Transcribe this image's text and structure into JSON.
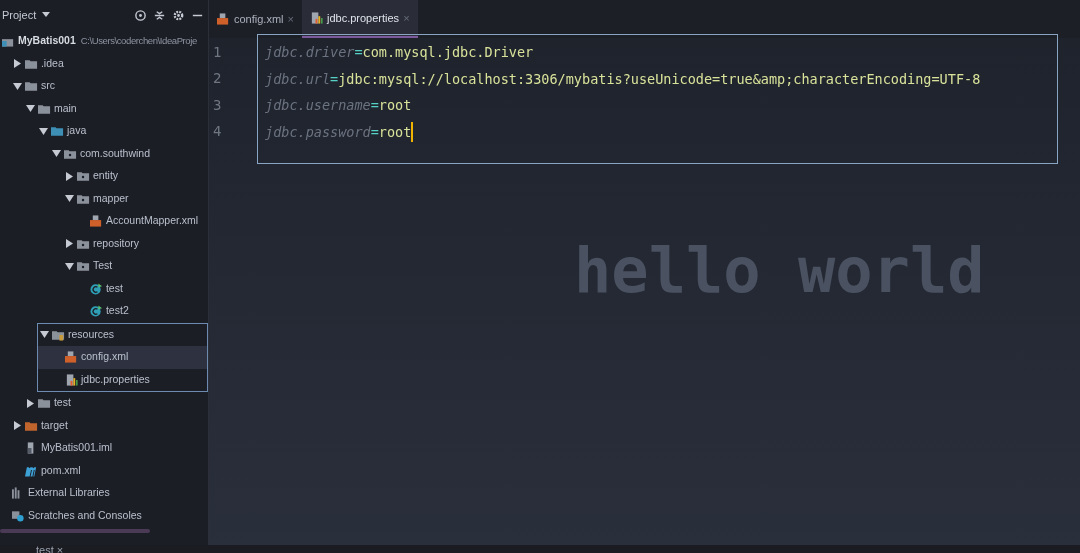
{
  "project_panel": {
    "title": "Project",
    "tree": [
      {
        "label": "MyBatis001",
        "path": "C:\\Users\\coderchen\\IdeaProje",
        "kind": "module",
        "selected": false,
        "children": [
          {
            "label": ".idea",
            "kind": "folder",
            "expanded": false,
            "selected": false
          },
          {
            "label": "src",
            "kind": "folder",
            "expanded": true,
            "selected": false,
            "children": [
              {
                "label": "main",
                "kind": "folder",
                "expanded": true,
                "selected": false,
                "children": [
                  {
                    "label": "java",
                    "kind": "source",
                    "expanded": true,
                    "selected": false,
                    "children": [
                      {
                        "label": "com.southwind",
                        "kind": "package",
                        "expanded": true,
                        "selected": false,
                        "children": [
                          {
                            "label": "entity",
                            "kind": "package",
                            "expanded": false,
                            "selected": false
                          },
                          {
                            "label": "mapper",
                            "kind": "package",
                            "expanded": true,
                            "selected": false,
                            "children": [
                              {
                                "label": "AccountMapper.xml",
                                "kind": "xml",
                                "selected": false
                              }
                            ]
                          },
                          {
                            "label": "repository",
                            "kind": "package",
                            "expanded": false,
                            "selected": false
                          },
                          {
                            "label": "Test",
                            "kind": "package",
                            "expanded": true,
                            "selected": false,
                            "children": [
                              {
                                "label": "test",
                                "kind": "class",
                                "selected": false
                              },
                              {
                                "label": "test2",
                                "kind": "class",
                                "selected": false
                              }
                            ]
                          }
                        ]
                      }
                    ]
                  },
                  {
                    "label": "resources",
                    "kind": "resources",
                    "expanded": true,
                    "selected": false,
                    "framed": true,
                    "children": [
                      {
                        "label": "config.xml",
                        "kind": "xml",
                        "selected": true
                      },
                      {
                        "label": "jdbc.properties",
                        "kind": "properties",
                        "selected": false
                      }
                    ]
                  }
                ]
              },
              {
                "label": "test",
                "kind": "folder",
                "expanded": false,
                "selected": false
              }
            ]
          },
          {
            "label": "target",
            "kind": "excluded",
            "expanded": false,
            "selected": false
          },
          {
            "label": "MyBatis001.iml",
            "kind": "iml",
            "selected": false
          },
          {
            "label": "pom.xml",
            "kind": "maven",
            "selected": false
          }
        ]
      },
      {
        "label": "External Libraries",
        "kind": "libraries",
        "selected": false
      },
      {
        "label": "Scratches and Consoles",
        "kind": "scratches",
        "selected": false
      }
    ]
  },
  "editor": {
    "tabs": [
      {
        "label": "config.xml",
        "kind": "xml",
        "selected": false,
        "close": "×"
      },
      {
        "label": "jdbc.properties",
        "kind": "properties",
        "selected": true,
        "close": "×"
      }
    ],
    "lines": [
      {
        "number": "1",
        "key": "jdbc.driver",
        "sep": "=",
        "value": "com.mysql.jdbc.Driver",
        "caret": false
      },
      {
        "number": "2",
        "key": "jdbc.url",
        "sep": "=",
        "value": "jdbc:mysql://localhost:3306/mybatis?useUnicode=true&amp;characterEncoding=UTF-8",
        "caret": false
      },
      {
        "number": "3",
        "key": "jdbc.username",
        "sep": "=",
        "value": "root",
        "caret": false
      },
      {
        "number": "4",
        "key": "jdbc.password",
        "sep": "=",
        "value": "root",
        "caret": true
      }
    ],
    "background_text": "hello world"
  },
  "bottom_tabs": [
    {
      "label": "test",
      "close": "×"
    }
  ]
}
